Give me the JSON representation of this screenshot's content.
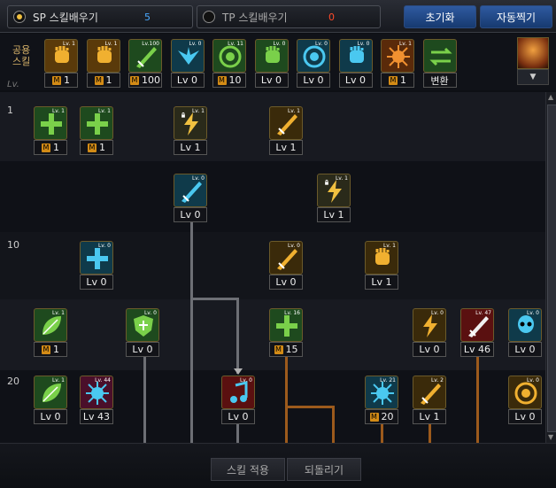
{
  "tabs": {
    "sp": {
      "label": "SP 스킬배우기",
      "points": "5"
    },
    "tp": {
      "label": "TP 스킬배우기",
      "points": "0"
    }
  },
  "buttons": {
    "reset": "초기화",
    "auto": "자동찍기",
    "apply": "스킬 적용",
    "undo": "되돌리기"
  },
  "common": {
    "label_line1": "공용",
    "label_line2": "스킬",
    "lv_label": "Lv."
  },
  "common_skills": [
    {
      "top": "Lv. 1",
      "value": "1",
      "m": true
    },
    {
      "top": "Lv. 1",
      "value": "1",
      "m": true
    },
    {
      "top": "Lv.100",
      "value": "100",
      "m": true
    },
    {
      "top": "Lv. 0",
      "value": "Lv 0",
      "m": false
    },
    {
      "top": "Lv. 11",
      "value": "10",
      "m": true
    },
    {
      "top": "Lv. 0",
      "value": "Lv 0",
      "m": false
    },
    {
      "top": "Lv. 0",
      "value": "Lv 0",
      "m": false
    },
    {
      "top": "Lv. 0",
      "value": "Lv 0",
      "m": false
    },
    {
      "top": "Lv. 1",
      "value": "1",
      "m": true
    },
    {
      "top": "",
      "value": "변환",
      "m": false
    }
  ],
  "rows": {
    "r1": "1",
    "r10": "10",
    "r20": "20"
  },
  "tree_skills": {
    "s1": {
      "top": "Lv. 1",
      "value": "1",
      "m": true
    },
    "s2": {
      "top": "Lv. 1",
      "value": "1",
      "m": true
    },
    "s3": {
      "top": "Lv. 1",
      "value": "Lv 1",
      "m": false
    },
    "s4": {
      "top": "Lv. 1",
      "value": "Lv 1",
      "m": false
    },
    "s5": {
      "top": "Lv. 0",
      "value": "Lv 0",
      "m": false
    },
    "s6": {
      "top": "Lv. 1",
      "value": "Lv 1",
      "m": false
    },
    "s7": {
      "top": "Lv. 0",
      "value": "Lv 0",
      "m": false
    },
    "s8": {
      "top": "Lv. 0",
      "value": "Lv 0",
      "m": false
    },
    "s9": {
      "top": "Lv. 1",
      "value": "Lv 1",
      "m": false
    },
    "s10": {
      "top": "Lv. 1",
      "value": "1",
      "m": true
    },
    "s11": {
      "top": "Lv. 0",
      "value": "Lv 0",
      "m": false
    },
    "s12": {
      "top": "Lv. 16",
      "value": "15",
      "m": true
    },
    "s13": {
      "top": "Lv. 0",
      "value": "Lv 0",
      "m": false
    },
    "s14": {
      "top": "Lv. 47",
      "value": "Lv 46",
      "m": false
    },
    "s15": {
      "top": "Lv. 0",
      "value": "Lv 0",
      "m": false
    },
    "s16": {
      "top": "Lv. 1",
      "value": "Lv 0",
      "m": false
    },
    "s17": {
      "top": "Lv. 44",
      "value": "Lv 43",
      "m": false
    },
    "s18": {
      "top": "Lv. 0",
      "value": "Lv 0",
      "m": false
    },
    "s19": {
      "top": "Lv. 21",
      "value": "20",
      "m": true
    },
    "s20": {
      "top": "Lv. 2",
      "value": "Lv 1",
      "m": false
    },
    "s21": {
      "top": "Lv. 0",
      "value": "Lv 0",
      "m": false
    }
  },
  "colors": {
    "accent": "#f0c040",
    "sp_points": "#4aa8ff",
    "tp_points": "#ff4a2a",
    "line": "#6d6f75",
    "prereq": "#9c5a1c"
  }
}
